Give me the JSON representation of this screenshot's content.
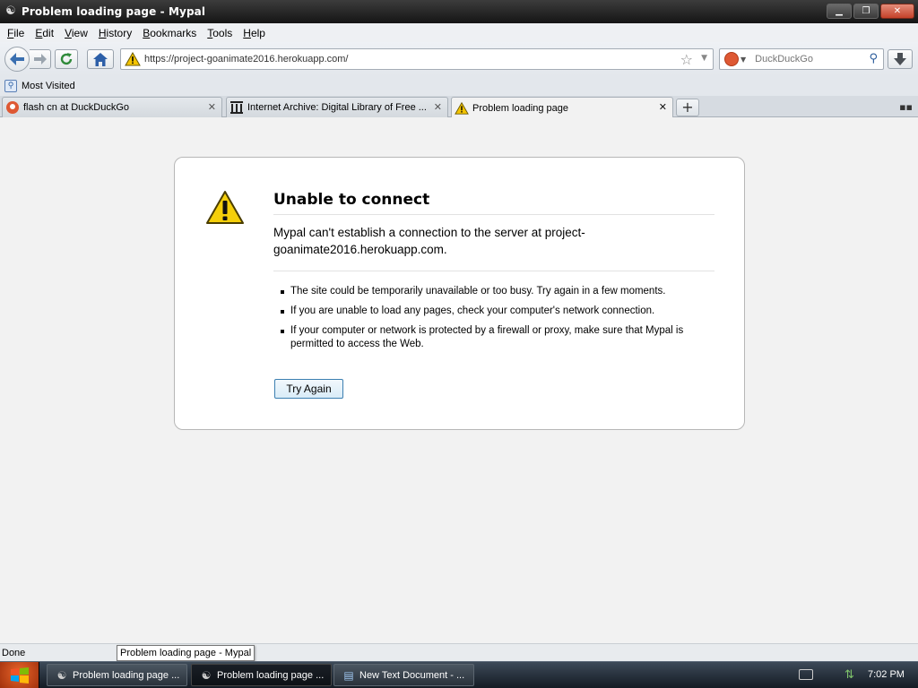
{
  "window": {
    "title": "Problem loading page - Mypal",
    "controls": {
      "minimize": "▁",
      "maximize": "❐",
      "close": "✕"
    }
  },
  "menu": [
    "File",
    "Edit",
    "View",
    "History",
    "Bookmarks",
    "Tools",
    "Help"
  ],
  "menu_mnemonics": [
    "F",
    "E",
    "V",
    "H",
    "B",
    "T",
    "H"
  ],
  "navbar": {
    "url": "https://project-goanimate2016.herokuapp.com/",
    "search_placeholder": "DuckDuckGo"
  },
  "bookmarks": {
    "items": [
      "Most Visited"
    ]
  },
  "tabs": [
    {
      "label": "flash cn at DuckDuckGo",
      "icon": "duckduckgo-icon",
      "active": false
    },
    {
      "label": "Internet Archive: Digital Library of Free ...",
      "icon": "internet-archive-icon",
      "active": false
    },
    {
      "label": "Problem loading page",
      "icon": "warning-icon",
      "active": true
    }
  ],
  "error": {
    "title": "Unable to connect",
    "description": "Mypal can't establish a connection to the server at project-goanimate2016.herokuapp.com.",
    "bullets": [
      "The site could be temporarily unavailable or too busy. Try again in a few moments.",
      "If you are unable to load any pages, check your computer's network connection.",
      "If your computer or network is protected by a firewall or proxy, make sure that Mypal is permitted to access the Web."
    ],
    "button": "Try Again"
  },
  "status": {
    "text": "Done",
    "tooltip": "Problem loading page - Mypal"
  },
  "taskbar": {
    "tasks": [
      {
        "label": "Problem loading page ...",
        "icon": "mypal-icon",
        "active": false
      },
      {
        "label": "Problem loading page ...",
        "icon": "mypal-icon",
        "active": true
      },
      {
        "label": "New Text Document - ...",
        "icon": "notepad-icon",
        "active": false
      }
    ],
    "clock": "7:02 PM"
  }
}
